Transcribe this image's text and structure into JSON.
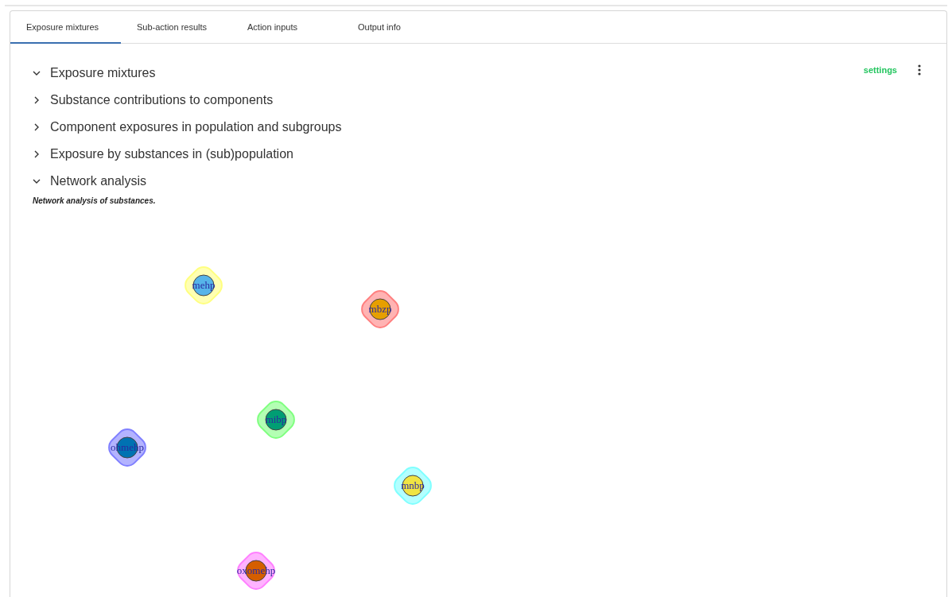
{
  "tabs": [
    {
      "label": "Exposure mixtures",
      "selected": true
    },
    {
      "label": "Sub-action results",
      "selected": false
    },
    {
      "label": "Action inputs",
      "selected": false
    },
    {
      "label": "Output info",
      "selected": false
    }
  ],
  "settings_link": "settings",
  "sections": [
    {
      "title": "Exposure mixtures",
      "expanded": true
    },
    {
      "title": "Substance contributions to components",
      "expanded": false
    },
    {
      "title": "Component exposures in population and subgroups",
      "expanded": false
    },
    {
      "title": "Exposure by substances in (sub)population",
      "expanded": false
    },
    {
      "title": "Network analysis",
      "expanded": true
    }
  ],
  "network": {
    "caption": "Network analysis of substances.",
    "nodes": [
      {
        "label": "mehp",
        "color": "#56b4e9",
        "group": {
          "color": "#ffff80"
        }
      },
      {
        "label": "mbzp",
        "color": "#e69f00",
        "group": {
          "color": "#ff8080"
        }
      },
      {
        "label": "mibp",
        "color": "#009e73",
        "group": {
          "color": "#80ff80"
        }
      },
      {
        "label": "ohmehp",
        "color": "#0072b2",
        "group": {
          "color": "#8080ff"
        }
      },
      {
        "label": "mnbp",
        "color": "#f0e442",
        "group": {
          "color": "#80ffff"
        }
      },
      {
        "label": "oxomehp",
        "color": "#d55e00",
        "group": {
          "color": "#ff80ff"
        }
      }
    ]
  }
}
